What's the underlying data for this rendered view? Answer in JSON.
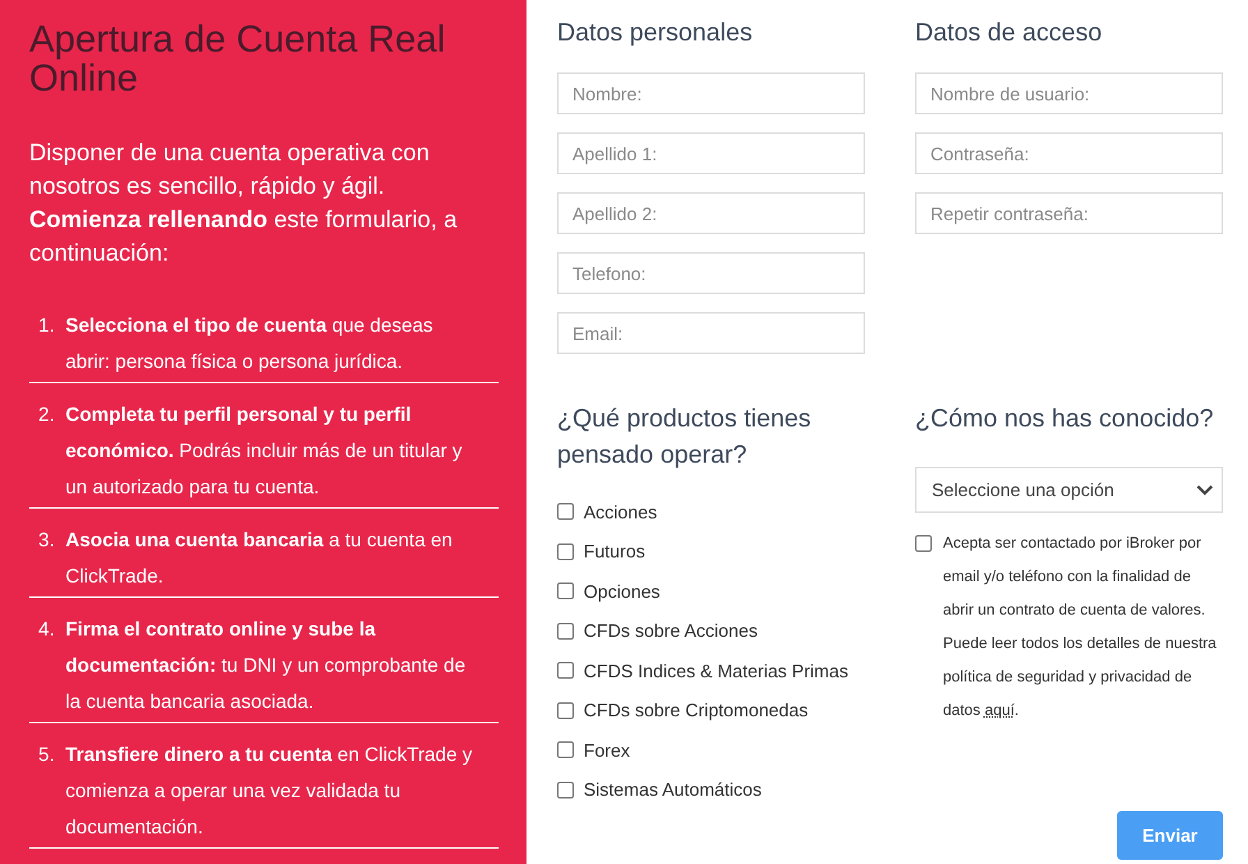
{
  "intro_panel": {
    "title": "Apertura de Cuenta Real Online",
    "paragraphs": [
      "Disponer de una cuenta operativa con nosotros es sencillo, rápido y ágil.",
      "**Comienza rellenando** este formulario, a continuación:"
    ],
    "steps": [
      {
        "number": "1.",
        "text": "**Selecciona el tipo de cuenta** que deseas abrir: persona física o persona jurídica."
      },
      {
        "number": "2.",
        "text": "**Completa tu perfil personal y tu perfil económico.** Podrás incluir más de un titular y un autorizado para tu cuenta."
      },
      {
        "number": "3.",
        "text": "**Asocia una cuenta bancaria** a tu cuenta en ClickTrade."
      },
      {
        "number": "4.",
        "text": "**Firma el contrato online y sube la documentación:** tu DNI y un comprobante de la cuenta bancaria asociada."
      },
      {
        "number": "5.",
        "text": "**Transfiere dinero a tu cuenta** en ClickTrade y comienza a operar una vez validada tu documentación."
      }
    ]
  },
  "personal": {
    "heading": "Datos personales",
    "fields": [
      {
        "placeholder": "Nombre:"
      },
      {
        "placeholder": "Apellido 1:"
      },
      {
        "placeholder": "Apellido 2:"
      },
      {
        "placeholder": "Telefono:"
      },
      {
        "placeholder": "Email:"
      }
    ]
  },
  "access": {
    "heading": "Datos de acceso",
    "fields": [
      {
        "placeholder": "Nombre de usuario:"
      },
      {
        "placeholder": "Contraseña:"
      },
      {
        "placeholder": "Repetir contraseña:"
      }
    ]
  },
  "products": {
    "heading": "¿Qué productos tienes pensado operar?",
    "options": [
      {
        "label": "Acciones",
        "checked": false
      },
      {
        "label": "Futuros",
        "checked": false
      },
      {
        "label": "Opciones",
        "checked": false
      },
      {
        "label": "CFDs sobre Acciones",
        "checked": false
      },
      {
        "label": "CFDS Indices & Materias Primas",
        "checked": false
      },
      {
        "label": "CFDs sobre Criptomonedas",
        "checked": false
      },
      {
        "label": "Forex",
        "checked": false
      },
      {
        "label": "Sistemas Automáticos",
        "checked": false
      }
    ]
  },
  "source": {
    "heading": "¿Cómo nos has conocido?",
    "select": {
      "placeholder": "Seleccione una opción"
    }
  },
  "consent": {
    "checked": false,
    "text": "Acepta ser contactado por iBroker por email y/o teléfono con la finalidad de abrir un contrato de cuenta de valores. Puede leer todos los detalles de nuestra política de seguridad y privacidad de datos",
    "link": "aquí",
    "end": "."
  },
  "submit": {
    "label": "Enviar"
  }
}
